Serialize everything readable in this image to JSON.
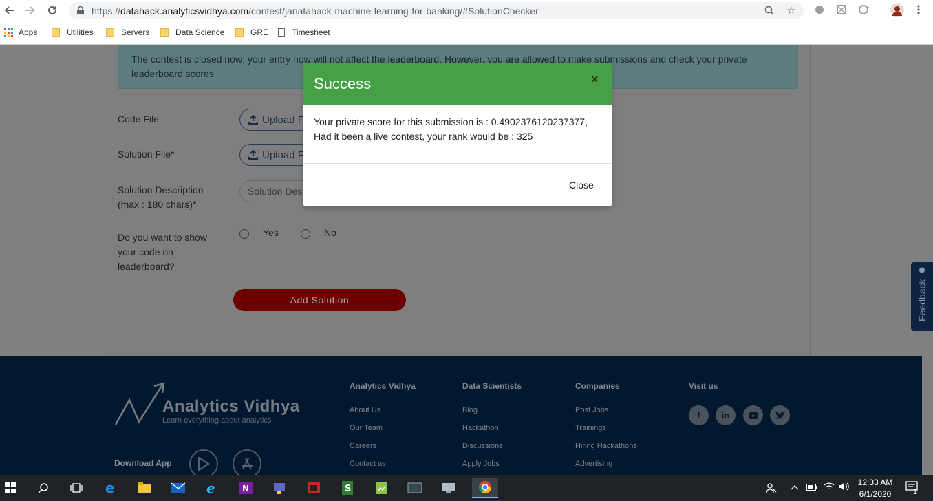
{
  "browser": {
    "url_prefix": "https://",
    "url_domain": "datahack.analyticsvidhya.com",
    "url_path": "/contest/janatahack-machine-learning-for-banking/#SolutionChecker",
    "bookmarks": [
      {
        "label": "Apps",
        "icon": "apps-grid-icon"
      },
      {
        "label": "Utilities",
        "icon": "folder-icon"
      },
      {
        "label": "Servers",
        "icon": "folder-icon"
      },
      {
        "label": "Data Science",
        "icon": "folder-icon"
      },
      {
        "label": "GRE",
        "icon": "folder-icon"
      },
      {
        "label": "Timesheet",
        "icon": "document-icon"
      }
    ]
  },
  "page": {
    "notice": "The contest is closed now; your entry now will not affect the leaderboard. However, you are allowed to make submissions and check your private leaderboard scores",
    "code_file_label": "Code File",
    "solution_file_label": "Solution File*",
    "upload_button_label": "Upload F",
    "description_label": "Solution Description (max : 180 chars)*",
    "description_placeholder": "Solution Des",
    "show_code_label": "Do you want to show your code on leaderboard?",
    "radio_yes": "Yes",
    "radio_no": "No",
    "add_solution": "Add Solution",
    "feedback_tab": "Feedback"
  },
  "footer": {
    "logo_text": "Analytics Vidhya",
    "logo_tagline": "Learn everything about analytics",
    "download_app": "Download App",
    "columns": [
      {
        "title": "Analytics Vidhya",
        "links": [
          "About Us",
          "Our Team",
          "Careers",
          "Contact us"
        ]
      },
      {
        "title": "Data Scientists",
        "links": [
          "Blog",
          "Hackathon",
          "Discussions",
          "Apply Jobs"
        ]
      },
      {
        "title": "Companies",
        "links": [
          "Post Jobs",
          "Trainings",
          "Hiring Hackathons",
          "Advertising"
        ]
      },
      {
        "title": "Visit us",
        "links": []
      }
    ],
    "social": [
      "facebook-icon",
      "linkedin-icon",
      "youtube-icon",
      "twitter-icon"
    ]
  },
  "modal": {
    "title": "Success",
    "close_x": "×",
    "message_line1": "Your private score for this submission is : 0.4902376120237377,",
    "message_line2": "Had it been a live contest, your rank would be : 325",
    "close_button": "Close"
  },
  "taskbar": {
    "time": "12:33 AM",
    "date": "6/1/2020",
    "notifications": "1"
  },
  "colors": {
    "modal_header": "#46a046",
    "footer_bg": "#02182f",
    "add_button": "#6d0000"
  }
}
